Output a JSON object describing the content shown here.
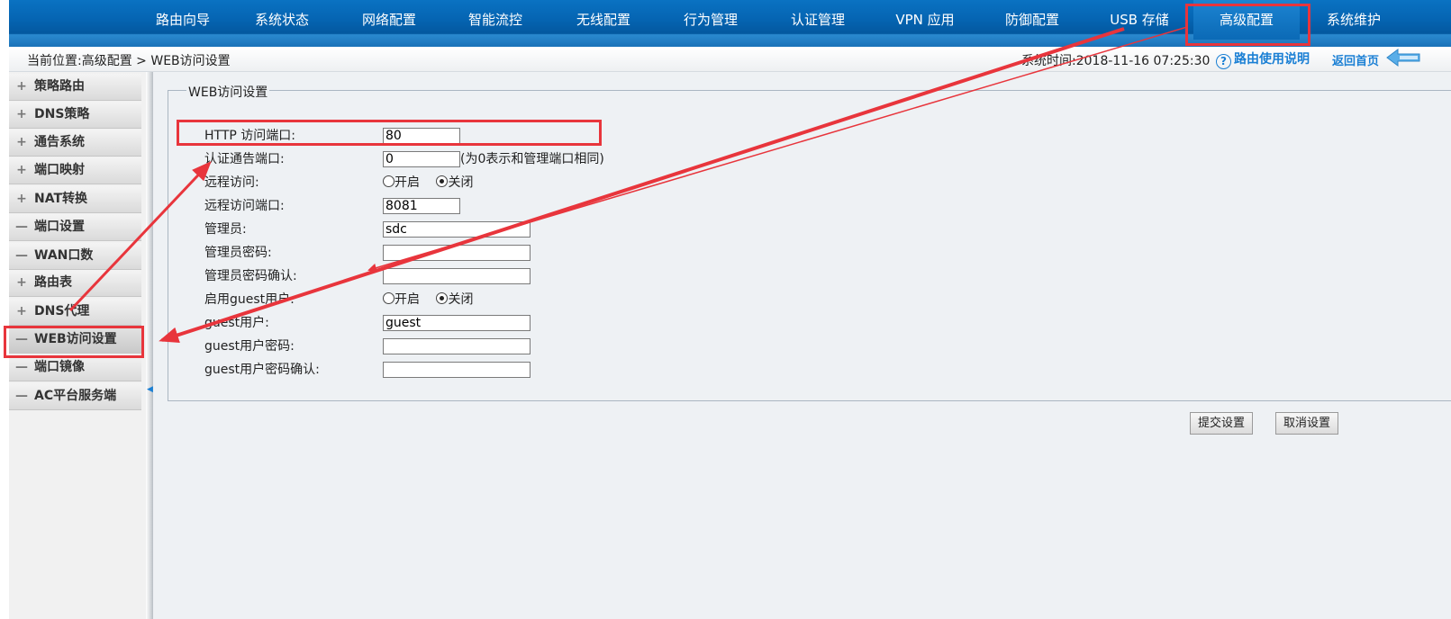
{
  "nav": {
    "items": [
      "路由向导",
      "系统状态",
      "网络配置",
      "智能流控",
      "无线配置",
      "行为管理",
      "认证管理",
      "VPN 应用",
      "防御配置",
      "USB 存储",
      "高级配置",
      "系统维护"
    ],
    "active_index": 10
  },
  "breadcrumb": {
    "text": "当前位置:高级配置 > WEB访问设置",
    "system_time": "系统时间:2018-11-16 07:25:30",
    "help_label": "路由使用说明",
    "home_label": "返回首页"
  },
  "sidebar": {
    "items": [
      {
        "symbol": "+",
        "label": "策略路由"
      },
      {
        "symbol": "+",
        "label": "DNS策略"
      },
      {
        "symbol": "+",
        "label": "通告系统"
      },
      {
        "symbol": "+",
        "label": "端口映射"
      },
      {
        "symbol": "+",
        "label": "NAT转换"
      },
      {
        "symbol": "—",
        "label": "端口设置"
      },
      {
        "symbol": "—",
        "label": "WAN口数"
      },
      {
        "symbol": "+",
        "label": "路由表"
      },
      {
        "symbol": "+",
        "label": "DNS代理"
      },
      {
        "symbol": "—",
        "label": "WEB访问设置"
      },
      {
        "symbol": "—",
        "label": "端口镜像"
      },
      {
        "symbol": "—",
        "label": "AC平台服务端"
      }
    ],
    "active_index": 9
  },
  "form": {
    "legend": "WEB访问设置",
    "http_port": {
      "label": "HTTP 访问端口:",
      "value": "80"
    },
    "auth_port": {
      "label": "认证通告端口:",
      "value": "0",
      "note": "(为0表示和管理端口相同)"
    },
    "remote_access": {
      "label": "远程访问:",
      "on_label": "开启",
      "off_label": "关闭",
      "selected": "off"
    },
    "remote_port": {
      "label": "远程访问端口:",
      "value": "8081"
    },
    "admin": {
      "label": "管理员:",
      "value": "sdc"
    },
    "admin_password": {
      "label": "管理员密码:",
      "value": ""
    },
    "admin_password_confirm": {
      "label": "管理员密码确认:",
      "value": ""
    },
    "guest_enable": {
      "label": "启用guest用户:",
      "on_label": "开启",
      "off_label": "关闭",
      "selected": "off"
    },
    "guest_user": {
      "label": "guest用户:",
      "value": "guest"
    },
    "guest_password": {
      "label": "guest用户密码:",
      "value": ""
    },
    "guest_password_confirm": {
      "label": "guest用户密码确认:",
      "value": ""
    }
  },
  "buttons": {
    "submit": "提交设置",
    "cancel": "取消设置"
  },
  "colors": {
    "nav_bg": "#0565b3",
    "link": "#1a7fd4",
    "annotation": "#e8353c",
    "main_bg": "#eef1f4"
  }
}
